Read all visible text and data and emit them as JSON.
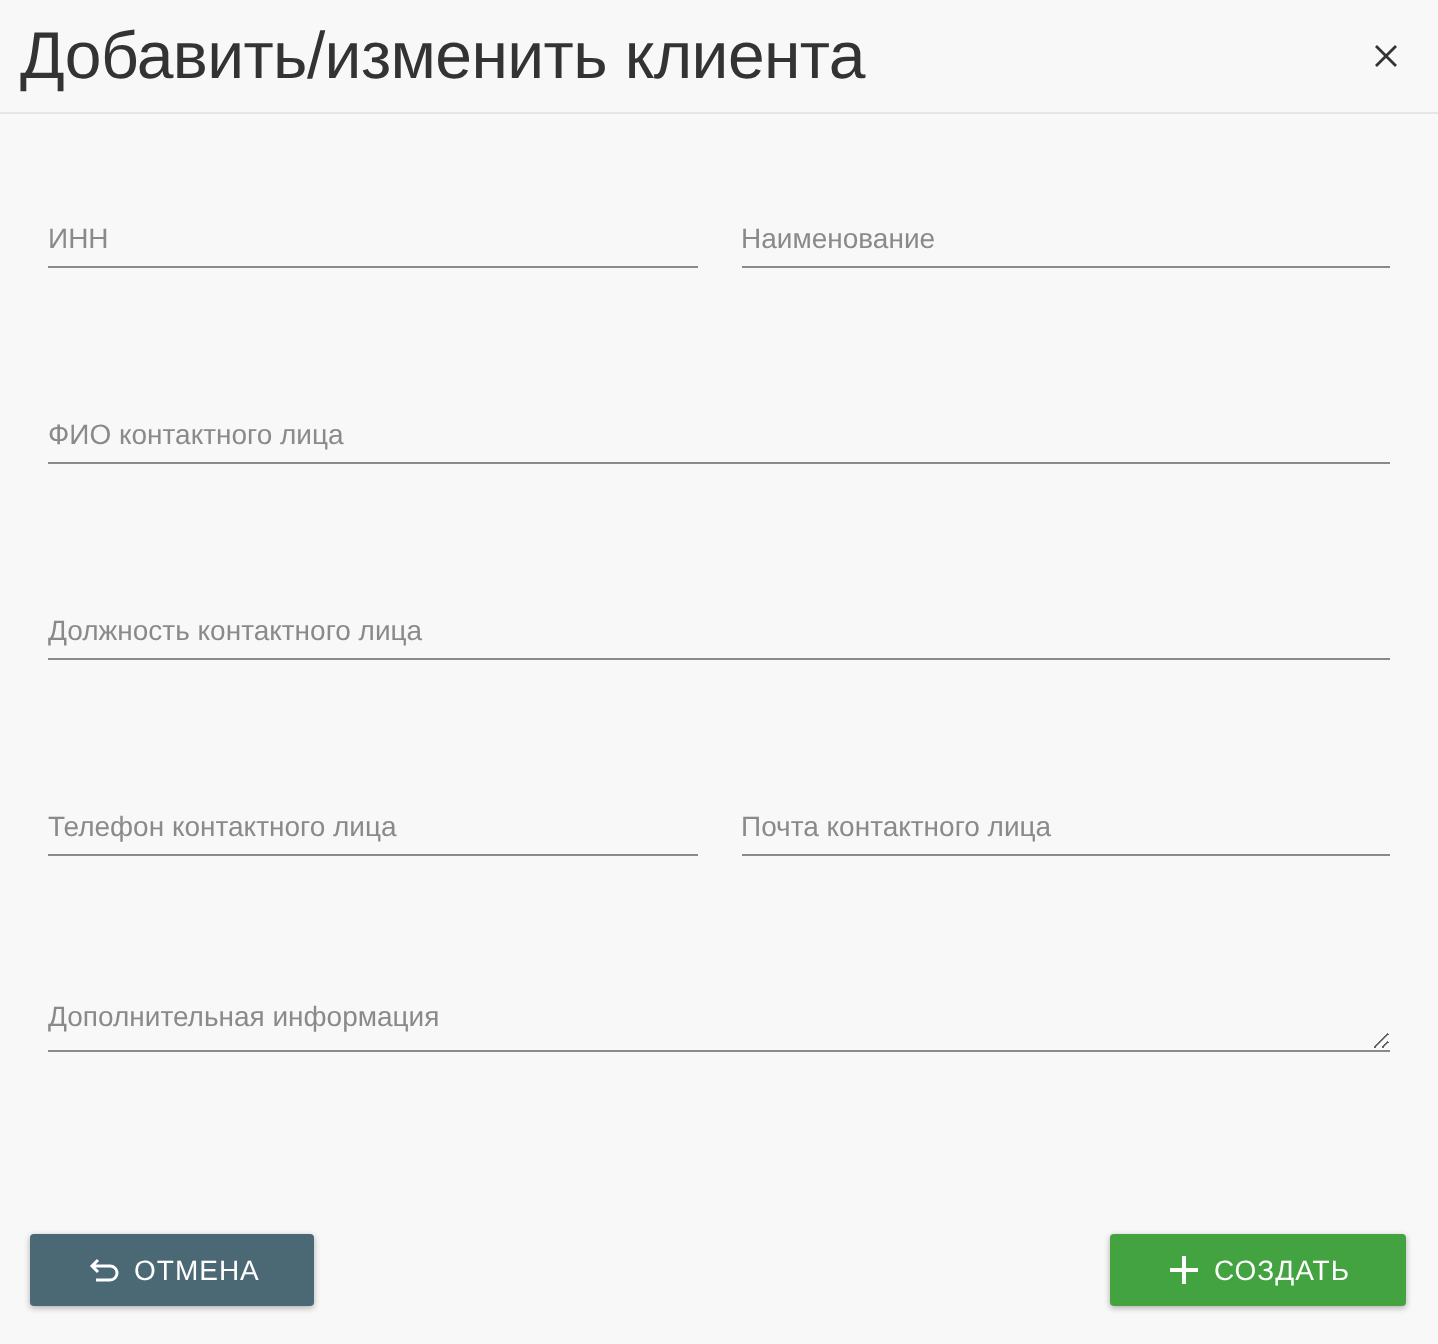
{
  "dialog": {
    "title": "Добавить/изменить клиента"
  },
  "form": {
    "rows": [
      {
        "fields": [
          {
            "kind": "input",
            "placeholder": "ИНН"
          },
          {
            "kind": "input",
            "placeholder": "Наименование"
          }
        ]
      },
      {
        "fields": [
          {
            "kind": "input",
            "placeholder": "ФИО контактного лица"
          }
        ]
      },
      {
        "fields": [
          {
            "kind": "input",
            "placeholder": "Должность контактного лица"
          }
        ]
      },
      {
        "fields": [
          {
            "kind": "input",
            "placeholder": "Телефон контактного лица"
          },
          {
            "kind": "input",
            "placeholder": "Почта контактного лица"
          }
        ]
      },
      {
        "fields": [
          {
            "kind": "textarea",
            "placeholder": "Дополнительная информация"
          }
        ]
      }
    ]
  },
  "buttons": [
    {
      "kind": "cancel",
      "label": "ОТМЕНА"
    },
    {
      "kind": "create",
      "label": "СОЗДАТЬ"
    }
  ]
}
